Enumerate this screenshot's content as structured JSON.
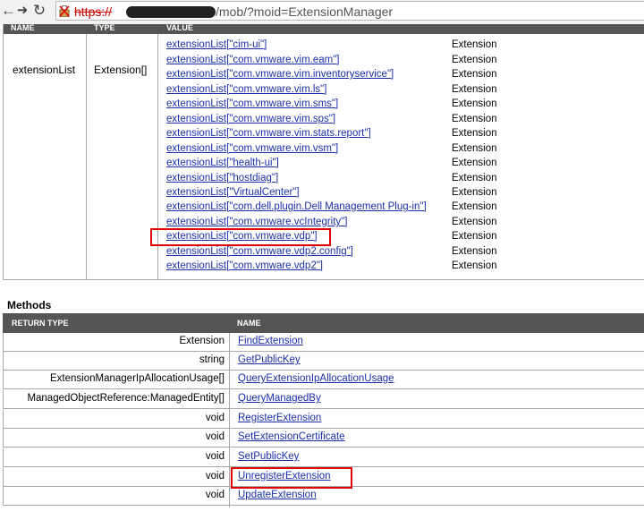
{
  "browser": {
    "url_scheme": "https://",
    "url_path": "/mob/?moid=ExtensionManager"
  },
  "properties": {
    "headers": {
      "name": "NAME",
      "type": "TYPE",
      "value": "VALUE"
    },
    "name": "extensionList",
    "type": "Extension[]",
    "values": [
      {
        "label": "extensionList[\"cim-ui\"]",
        "type": "Extension"
      },
      {
        "label": "extensionList[\"com.vmware.vim.eam\"]",
        "type": "Extension"
      },
      {
        "label": "extensionList[\"com.vmware.vim.inventoryservice\"]",
        "type": "Extension"
      },
      {
        "label": "extensionList[\"com.vmware.vim.ls\"]",
        "type": "Extension"
      },
      {
        "label": "extensionList[\"com.vmware.vim.sms\"]",
        "type": "Extension"
      },
      {
        "label": "extensionList[\"com.vmware.vim.sps\"]",
        "type": "Extension"
      },
      {
        "label": "extensionList[\"com.vmware.vim.stats.report\"]",
        "type": "Extension"
      },
      {
        "label": "extensionList[\"com.vmware.vim.vsm\"]",
        "type": "Extension"
      },
      {
        "label": "extensionList[\"health-ui\"]",
        "type": "Extension"
      },
      {
        "label": "extensionList[\"hostdiag\"]",
        "type": "Extension"
      },
      {
        "label": "extensionList[\"VirtualCenter\"]",
        "type": "Extension"
      },
      {
        "label": "extensionList[\"com.dell.plugin.Dell Management Plug-in\"]",
        "type": "Extension"
      },
      {
        "label": "extensionList[\"com.vmware.vcIntegrity\"]",
        "type": "Extension"
      },
      {
        "label": "extensionList[\"com.vmware.vdp\"]",
        "type": "Extension"
      },
      {
        "label": "extensionList[\"com.vmware.vdp2.config\"]",
        "type": "Extension"
      },
      {
        "label": "extensionList[\"com.vmware.vdp2\"]",
        "type": "Extension"
      }
    ]
  },
  "methods": {
    "title": "Methods",
    "headers": {
      "return_type": "RETURN TYPE",
      "name": "NAME"
    },
    "rows": [
      {
        "return_type": "Extension",
        "name": "FindExtension"
      },
      {
        "return_type": "string",
        "name": "GetPublicKey"
      },
      {
        "return_type": "ExtensionManagerIpAllocationUsage[]",
        "name": "QueryExtensionIpAllocationUsage"
      },
      {
        "return_type": "ManagedObjectReference:ManagedEntity[]",
        "name": "QueryManagedBy"
      },
      {
        "return_type": "void",
        "name": "RegisterExtension"
      },
      {
        "return_type": "void",
        "name": "SetExtensionCertificate"
      },
      {
        "return_type": "void",
        "name": "SetPublicKey"
      },
      {
        "return_type": "void",
        "name": "UnregisterExtension"
      },
      {
        "return_type": "void",
        "name": "UpdateExtension"
      }
    ]
  },
  "colors": {
    "link": "#1a30a8",
    "highlight": "#e00000",
    "header_bg": "#555555"
  }
}
